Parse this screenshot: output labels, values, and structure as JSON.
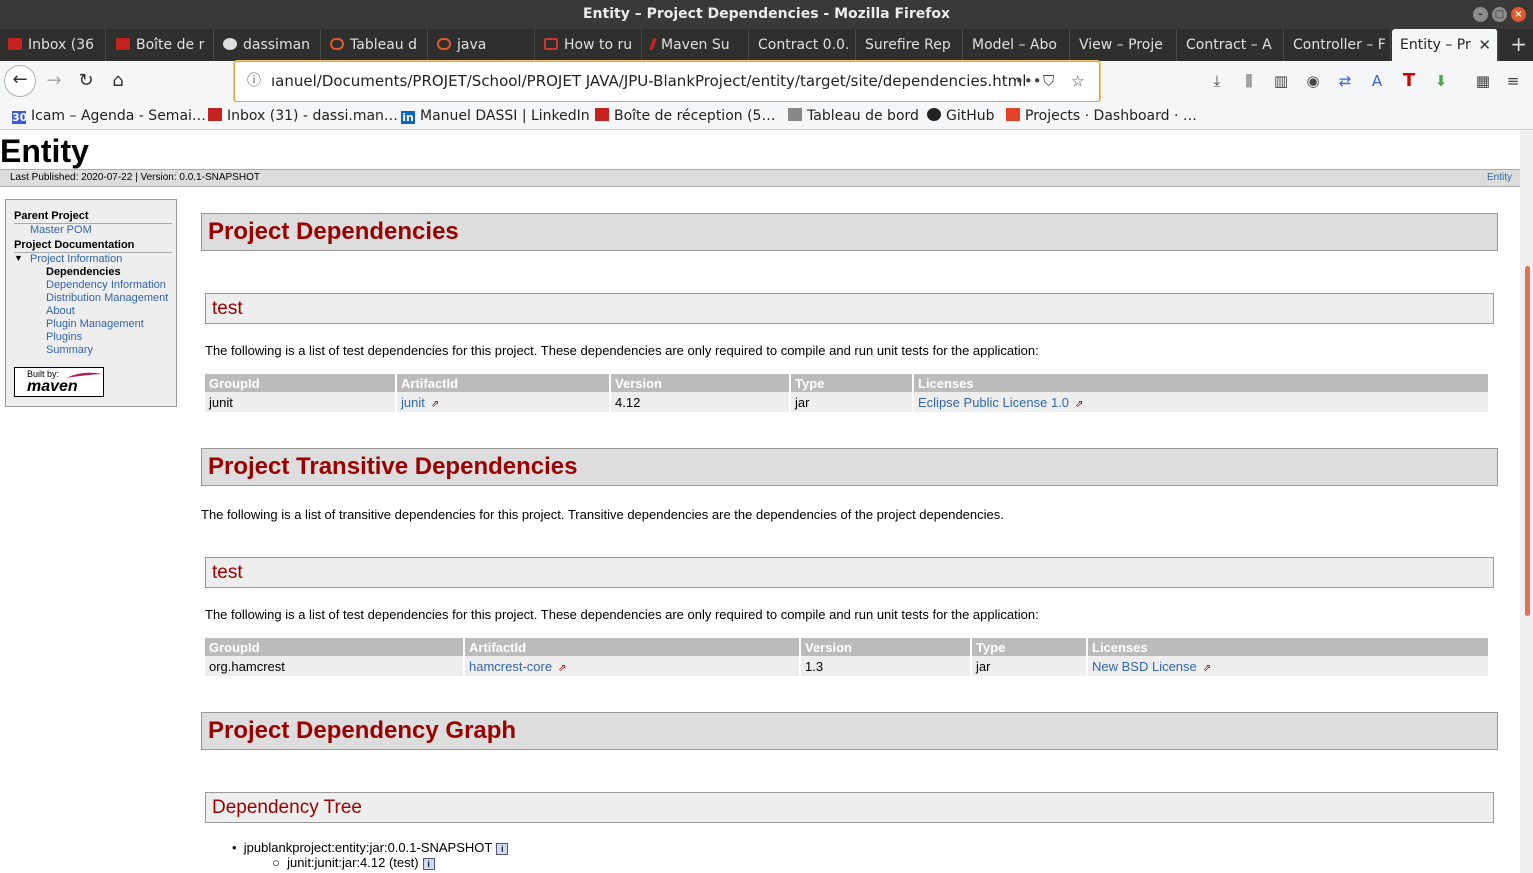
{
  "window": {
    "title": "Entity – Project Dependencies - Mozilla Firefox"
  },
  "tabs": [
    {
      "label": "Inbox (36",
      "icon": "gmail-icon"
    },
    {
      "label": "Boîte de r",
      "icon": "gmail-icon"
    },
    {
      "label": "dassiman",
      "icon": "github-icon"
    },
    {
      "label": "Tableau d",
      "icon": "cloud-icon"
    },
    {
      "label": "java",
      "icon": "cloud-icon"
    },
    {
      "label": "How to ru",
      "icon": "site-icon"
    },
    {
      "label": "Maven Su",
      "icon": "maven-icon"
    },
    {
      "label": "Contract 0.0.",
      "icon": ""
    },
    {
      "label": "Surefire Rep",
      "icon": ""
    },
    {
      "label": "Model – Abo",
      "icon": ""
    },
    {
      "label": "View – Proje",
      "icon": ""
    },
    {
      "label": "Contract – A",
      "icon": ""
    },
    {
      "label": "Controller – F",
      "icon": ""
    },
    {
      "label": "Entity – Pr",
      "icon": "",
      "active": true
    }
  ],
  "navbar": {
    "url": "ıanuel/Documents/PROJET/School/PROJET JAVA/JPU-BlankProject/entity/target/site/dependencies.html"
  },
  "bookmarks": [
    {
      "label": "Icam – Agenda - Semai…",
      "icon": "calendar-icon",
      "badge": "30"
    },
    {
      "label": "Inbox (31) - dassi.man…",
      "icon": "gmail-icon"
    },
    {
      "label": "Manuel DASSI | LinkedIn",
      "icon": "linkedin-icon",
      "badge": "in"
    },
    {
      "label": "Boîte de réception (5…",
      "icon": "gmail-icon"
    },
    {
      "label": "Tableau de bord",
      "icon": "dashboard-icon"
    },
    {
      "label": "GitHub",
      "icon": "github-icon"
    },
    {
      "label": "Projects · Dashboard · …",
      "icon": "gitlab-icon"
    }
  ],
  "page": {
    "banner_title": "Entity",
    "published": "Last Published: 2020-07-22",
    "version": "| Version: 0.0.1-SNAPSHOT",
    "crumb_right": "Entity"
  },
  "sidebar": {
    "parent_heading": "Parent Project",
    "parent_link": "Master POM",
    "doc_heading": "Project Documentation",
    "info_link": "Project Information",
    "items": [
      "Dependencies",
      "Dependency Information",
      "Distribution Management",
      "About",
      "Plugin Management",
      "Plugins",
      "Summary"
    ],
    "built_by": "Built by:",
    "maven_logo": "maven"
  },
  "sections": {
    "deps_title": "Project Dependencies",
    "test_title": "test",
    "test_para": "The following is a list of test dependencies for this project. These dependencies are only required to compile and run unit tests for the application:",
    "trans_title": "Project Transitive Dependencies",
    "trans_para": "The following is a list of transitive dependencies for this project. Transitive dependencies are the dependencies of the project dependencies.",
    "trans_test_title": "test",
    "trans_test_para": "The following is a list of test dependencies for this project. These dependencies are only required to compile and run unit tests for the application:",
    "graph_title": "Project Dependency Graph",
    "tree_title": "Dependency Tree"
  },
  "table_headers": [
    "GroupId",
    "ArtifactId",
    "Version",
    "Type",
    "Licenses"
  ],
  "deps_table": [
    {
      "group": "junit",
      "artifact": "junit",
      "version": "4.12",
      "type": "jar",
      "license": "Eclipse Public License 1.0"
    }
  ],
  "trans_table": [
    {
      "group": "org.hamcrest",
      "artifact": "hamcrest-core",
      "version": "1.3",
      "type": "jar",
      "license": "New BSD License"
    }
  ],
  "tree": {
    "root": "jpublankproject:entity:jar:0.0.1-SNAPSHOT",
    "child": "junit:junit:jar:4.12 (test)"
  }
}
